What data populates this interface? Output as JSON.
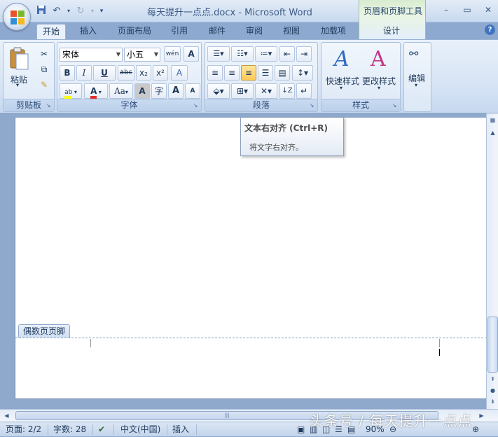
{
  "window": {
    "title": "每天提升一点点.docx - Microsoft Word",
    "context_group": "页眉和页脚工具",
    "controls": [
      "–",
      "▭",
      "✕"
    ]
  },
  "tabs": [
    {
      "label": "开始",
      "active": true
    },
    {
      "label": "插入"
    },
    {
      "label": "页面布局"
    },
    {
      "label": "引用"
    },
    {
      "label": "邮件"
    },
    {
      "label": "审阅"
    },
    {
      "label": "视图"
    },
    {
      "label": "加载项"
    },
    {
      "label": "设计"
    }
  ],
  "ribbon": {
    "clipboard": {
      "group_label": "剪贴板",
      "paste_label": "粘贴"
    },
    "font": {
      "group_label": "字体",
      "font_name": "宋体",
      "font_size": "小五",
      "bold": "B",
      "italic": "I",
      "underline": "U",
      "strike": "abc",
      "subscript": "x₂",
      "superscript": "x²",
      "grow": "A",
      "shrink": "A",
      "case": "Aa",
      "char_border": "A",
      "phonetic": "wén",
      "clear": "A",
      "enclose": "字"
    },
    "paragraph": {
      "group_label": "段落"
    },
    "styles": {
      "group_label": "样式",
      "quick_styles": "快速样式",
      "change_styles": "更改样式"
    },
    "editing": {
      "label": "编辑"
    }
  },
  "tooltip": {
    "title": "文本右对齐 (Ctrl+R)",
    "description": "将文字右对齐。"
  },
  "document": {
    "footer_tag": "偶数页页脚"
  },
  "statusbar": {
    "page": "页面: 2/2",
    "words": "字数: 28",
    "language": "中文(中国)",
    "mode": "插入",
    "zoom": "90%"
  },
  "watermark": "头条号 / 每天提升一点点",
  "colors": {
    "accent": "#ffc857",
    "ribbon_bg": "#dce8f6",
    "doc_bg": "#8fa9cd"
  }
}
